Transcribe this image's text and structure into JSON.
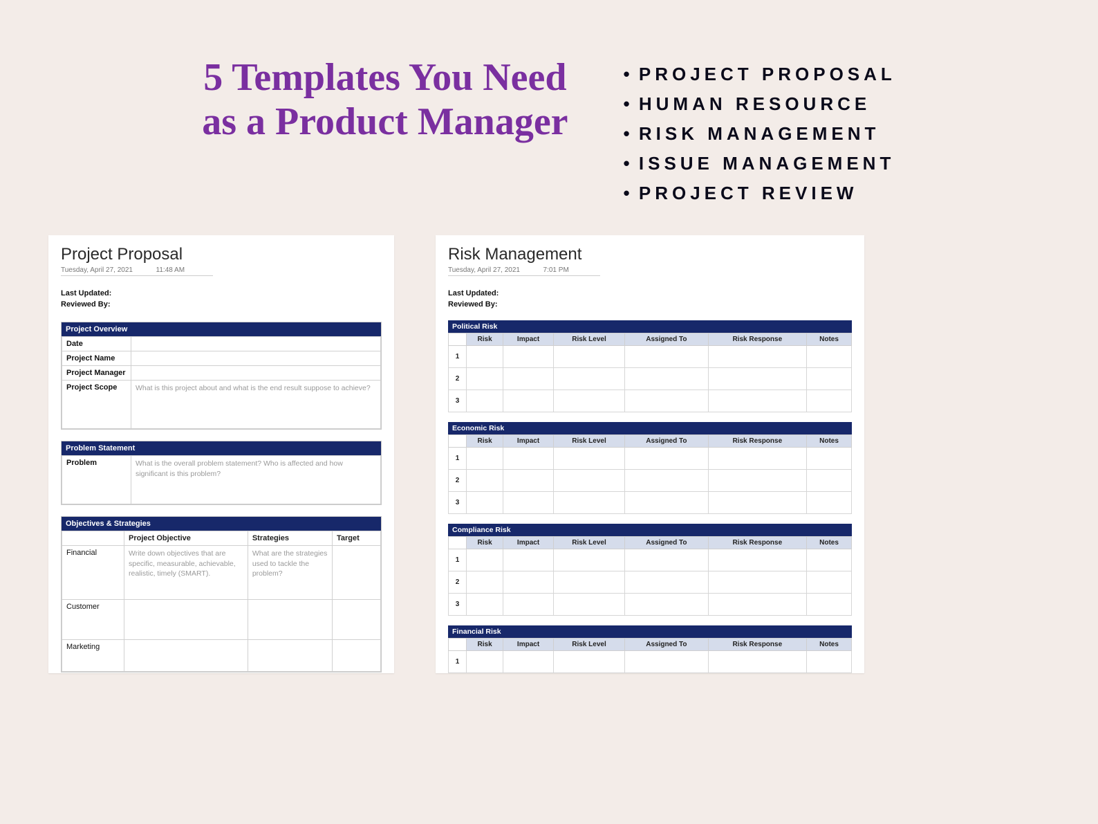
{
  "hero": {
    "title_line1": "5 Templates You Need",
    "title_line2": "as a Product Manager"
  },
  "bullets": [
    "PROJECT PROPOSAL",
    "HUMAN RESOURCE",
    "RISK MANAGEMENT",
    "ISSUE MANAGEMENT",
    "PROJECT REVIEW"
  ],
  "left_doc": {
    "title": "Project Proposal",
    "date": "Tuesday, April 27, 2021",
    "time": "11:48 AM",
    "last_updated_label": "Last Updated:",
    "reviewed_by_label": "Reviewed By:",
    "overview": {
      "heading": "Project Overview",
      "rows": [
        {
          "label": "Date",
          "value": ""
        },
        {
          "label": "Project Name",
          "value": ""
        },
        {
          "label": "Project Manager",
          "value": ""
        },
        {
          "label": "Project Scope",
          "value": "What is this project about and what is the end result suppose to achieve?"
        }
      ]
    },
    "problem": {
      "heading": "Problem Statement",
      "label": "Problem",
      "placeholder": "What is the overall problem statement? Who is affected and how significant is this problem?"
    },
    "objectives": {
      "heading": "Objectives & Strategies",
      "columns": [
        "",
        "Project Objective",
        "Strategies",
        "Target"
      ],
      "rows": [
        {
          "category": "Financial",
          "objective": "Write down objectives that are specific, measurable, achievable, realistic, timely (SMART).",
          "strategies": "What are the strategies used to tackle the problem?",
          "target": ""
        },
        {
          "category": "Customer",
          "objective": "",
          "strategies": "",
          "target": ""
        },
        {
          "category": "Marketing",
          "objective": "",
          "strategies": "",
          "target": ""
        }
      ]
    }
  },
  "right_doc": {
    "title": "Risk Management",
    "date": "Tuesday, April 27, 2021",
    "time": "7:01 PM",
    "last_updated_label": "Last Updated:",
    "reviewed_by_label": "Reviewed By:",
    "risk_columns": [
      "",
      "Risk",
      "Impact",
      "Risk Level",
      "Assigned To",
      "Risk Response",
      "Notes"
    ],
    "sections": [
      {
        "title": "Political Risk",
        "rows": [
          "1",
          "2",
          "3"
        ]
      },
      {
        "title": "Economic Risk",
        "rows": [
          "1",
          "2",
          "3"
        ]
      },
      {
        "title": "Compliance Risk",
        "rows": [
          "1",
          "2",
          "3"
        ]
      },
      {
        "title": "Financial Risk",
        "rows": [
          "1"
        ]
      }
    ]
  }
}
